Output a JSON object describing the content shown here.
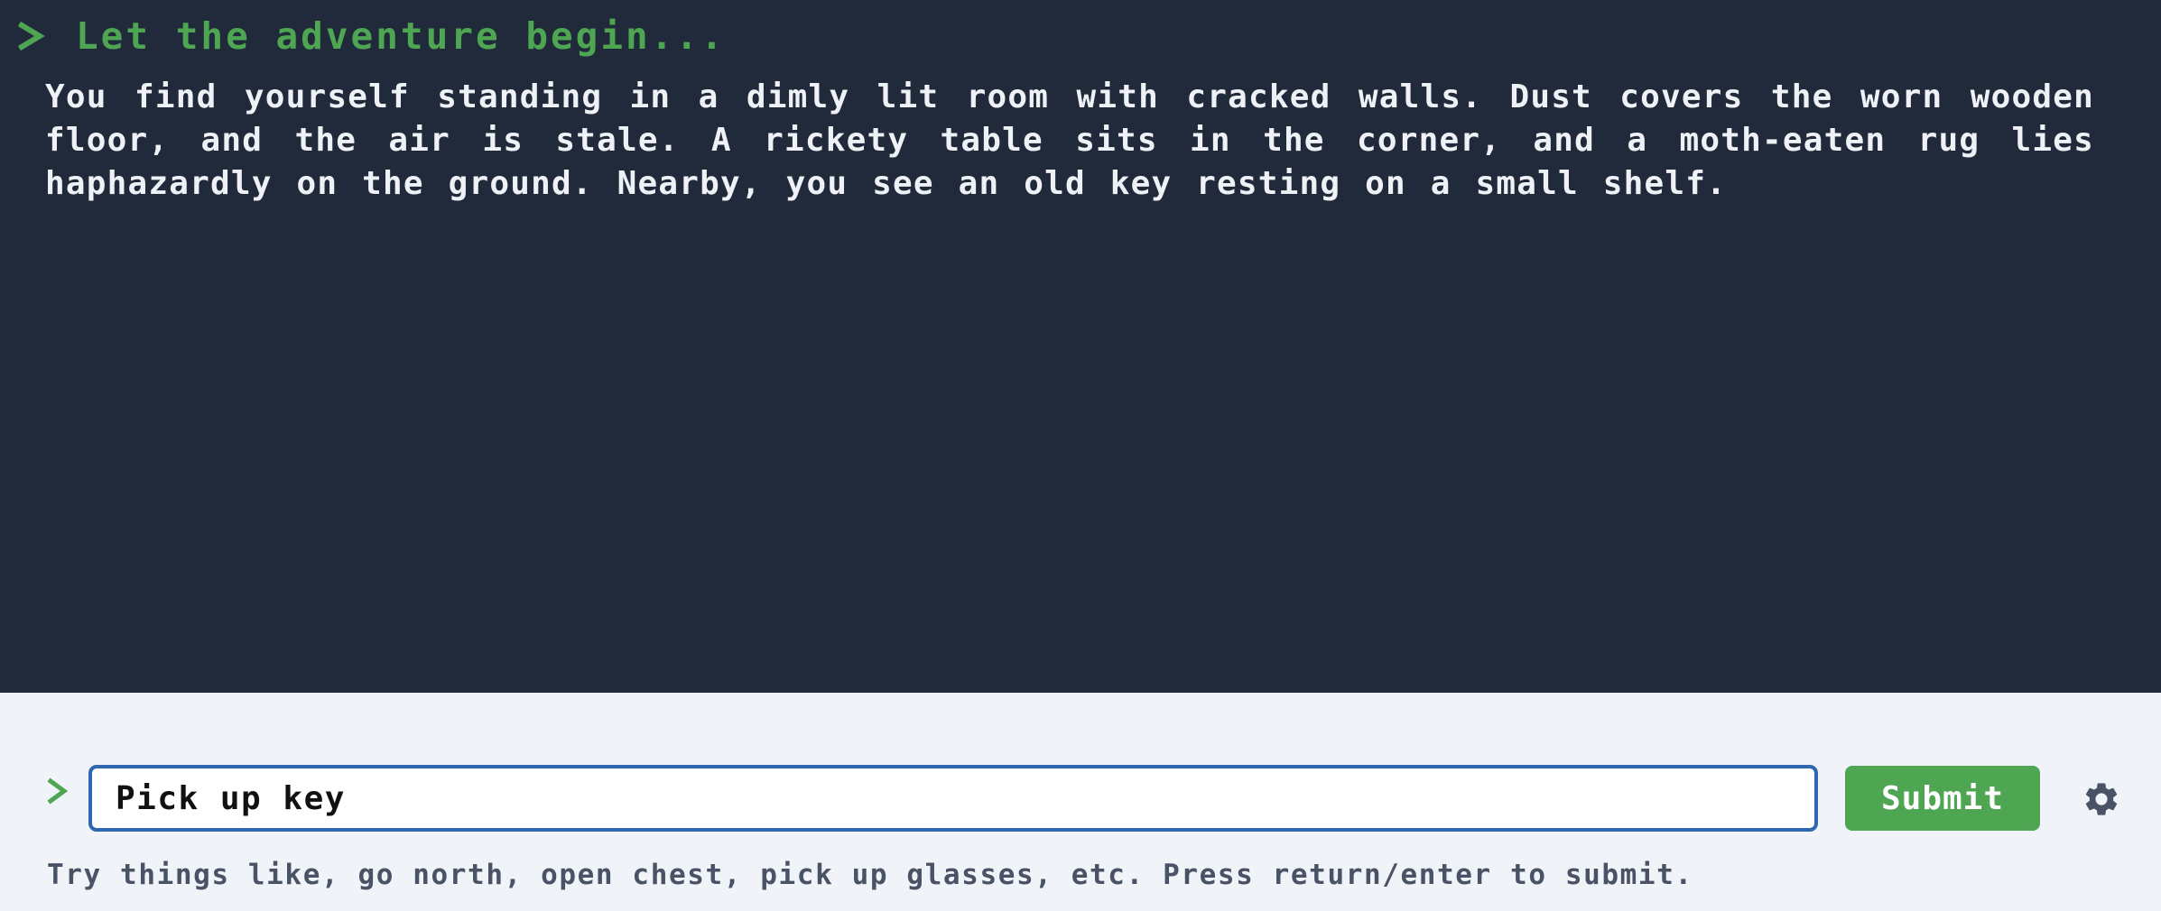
{
  "output": {
    "heading": "Let the adventure begin...",
    "prompt_icon": "chevron-right-icon",
    "story": "You find yourself standing in a dimly lit room with cracked walls. Dust covers the worn wooden floor, and the air is stale. A rickety table sits in the corner, and a moth-eaten rug lies haphazardly on the ground. Nearby, you see an old key resting on a small shelf."
  },
  "input": {
    "prompt_icon": "chevron-right-icon",
    "value": "Pick up key",
    "submit_label": "Submit",
    "settings_icon": "gear-icon",
    "hint": "Try things like, go north, open chest, pick up glasses, etc. Press return/enter to submit."
  },
  "colors": {
    "output_background": "#212a3b",
    "input_background": "#f0f3f8",
    "accent_green": "#4ea552",
    "input_border": "#2f67b0",
    "story_text": "#eef1f5",
    "hint_text": "#4a5366"
  }
}
